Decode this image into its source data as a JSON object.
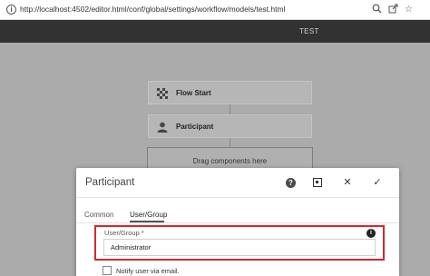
{
  "browser": {
    "url": "http://localhost:4502/editor.html/conf/global/settings/workflow/models/test.html",
    "icons": [
      "info-icon",
      "zoom-icon",
      "share-icon",
      "star-icon"
    ]
  },
  "app_header": {
    "title": "TEST"
  },
  "workflow": {
    "steps": [
      {
        "label": "Flow Start",
        "icon": "checkered-flag-icon"
      },
      {
        "label": "Participant",
        "icon": "person-icon"
      }
    ],
    "dropzone_label": "Drag components here"
  },
  "dialog": {
    "title": "Participant",
    "help_label": "?",
    "close_label": "✕",
    "confirm_label": "✓",
    "tabs": [
      {
        "label": "Common",
        "active": false
      },
      {
        "label": "User/Group",
        "active": true
      }
    ],
    "field": {
      "label": "User/Group *",
      "info_label": "i",
      "value": "Administrator"
    },
    "notify_label": "Notify user via email."
  },
  "colors": {
    "header_bg": "#323232",
    "overlay_bg": "#ababab",
    "highlight": "#d9262e"
  }
}
